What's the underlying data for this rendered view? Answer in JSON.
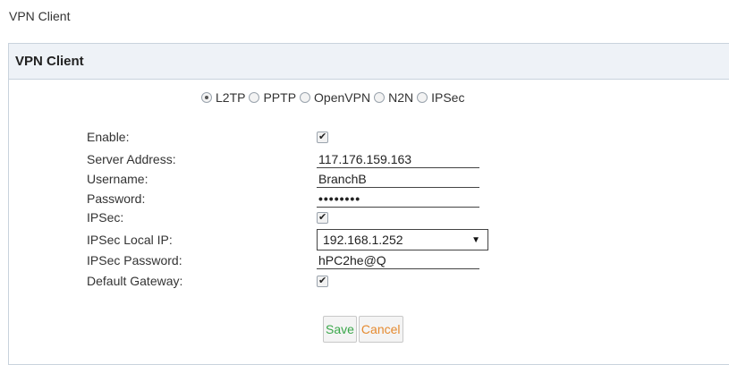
{
  "page": {
    "title": "VPN Client"
  },
  "panel": {
    "header": "VPN Client"
  },
  "protocols": {
    "selected": "L2TP",
    "options": [
      "L2TP",
      "PPTP",
      "OpenVPN",
      "N2N",
      "IPSec"
    ]
  },
  "form": {
    "enable": {
      "label": "Enable:",
      "checked": true
    },
    "server_address": {
      "label": "Server Address:",
      "value": "117.176.159.163"
    },
    "username": {
      "label": "Username:",
      "value": "BranchB"
    },
    "password": {
      "label": "Password:",
      "value": "••••••••"
    },
    "ipsec": {
      "label": "IPSec:",
      "checked": true
    },
    "ipsec_local_ip": {
      "label": "IPSec Local IP:",
      "value": "192.168.1.252"
    },
    "ipsec_password": {
      "label": "IPSec Password:",
      "value": "hPC2he@Q"
    },
    "default_gateway": {
      "label": "Default Gateway:",
      "checked": true
    }
  },
  "buttons": {
    "save": "Save",
    "cancel": "Cancel"
  }
}
